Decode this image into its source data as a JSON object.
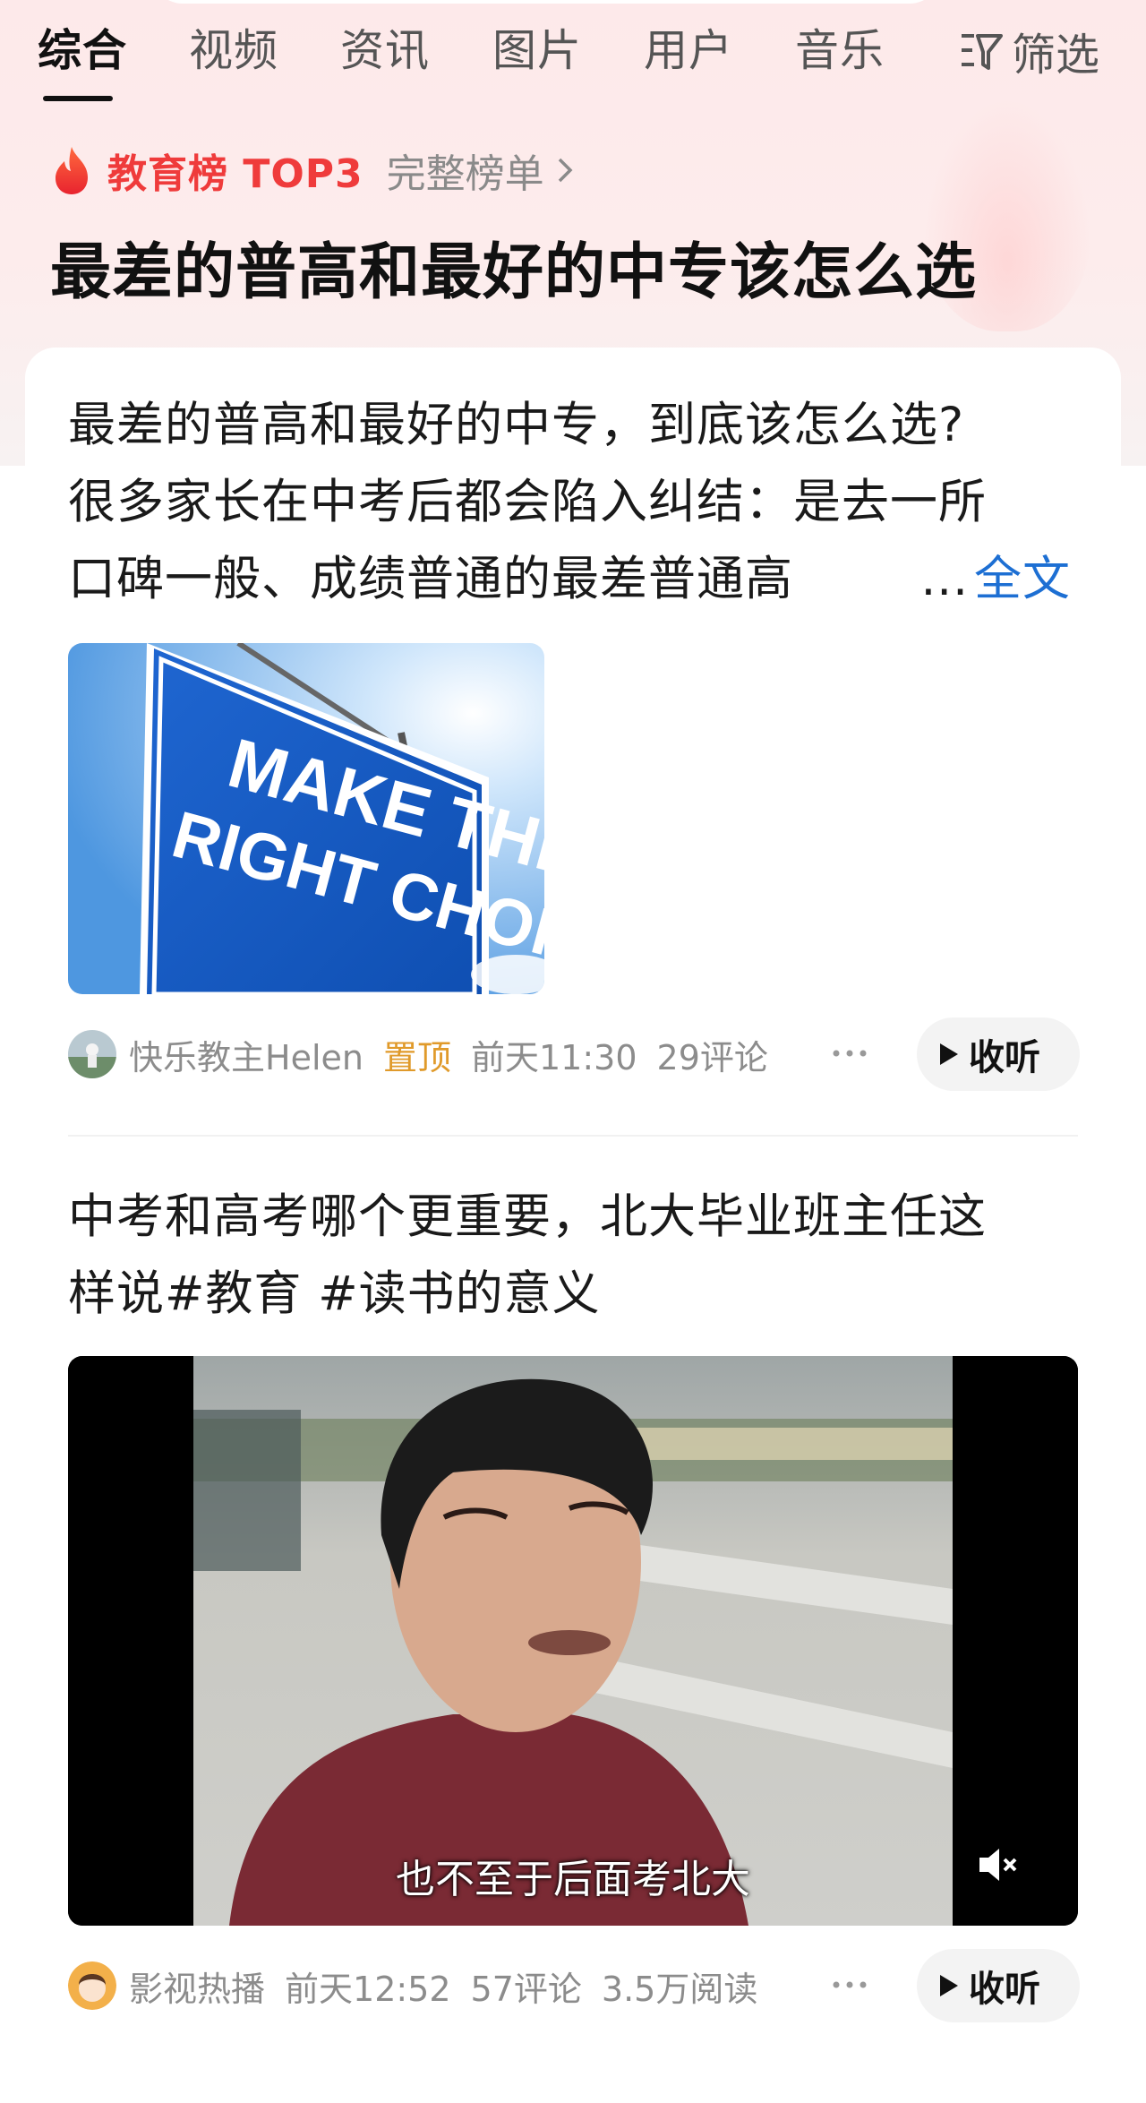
{
  "tabs": {
    "items": [
      "综合",
      "视频",
      "资讯",
      "图片",
      "用户",
      "音乐"
    ],
    "active_index": 0,
    "filter_label": "筛选"
  },
  "rank": {
    "title": "教育榜 TOP3",
    "more_label": "完整榜单"
  },
  "page_title": "最差的普高和最好的中专该怎么选",
  "post1": {
    "lines": [
      "最差的普高和最好的中专，到底该怎么选?",
      "很多家长在中考后都会陷入纠结：是去一所",
      "口碑一般、成绩普通的最差普通高"
    ],
    "ellipsis": "...",
    "expand_label": "全文",
    "image_text": [
      "MAKE THE",
      "RIGHT CHOICE"
    ],
    "author": "快乐教主Helen",
    "pinned": "置顶",
    "time": "前天11:30",
    "comments": "29评论",
    "listen_label": "收听"
  },
  "post2": {
    "lines": [
      "中考和高考哪个更重要，北大毕业班主任这",
      "样说#教育 #读书的意义"
    ],
    "video_subtitle": "也不至于后面考北大",
    "author": "影视热播",
    "time": "前天12:52",
    "comments": "57评论",
    "reads": "3.5万阅读",
    "listen_label": "收听"
  },
  "colors": {
    "accent_red": "#ef3b3b",
    "link_blue": "#1d6fd3",
    "pinned_orange": "#e09a2a"
  }
}
